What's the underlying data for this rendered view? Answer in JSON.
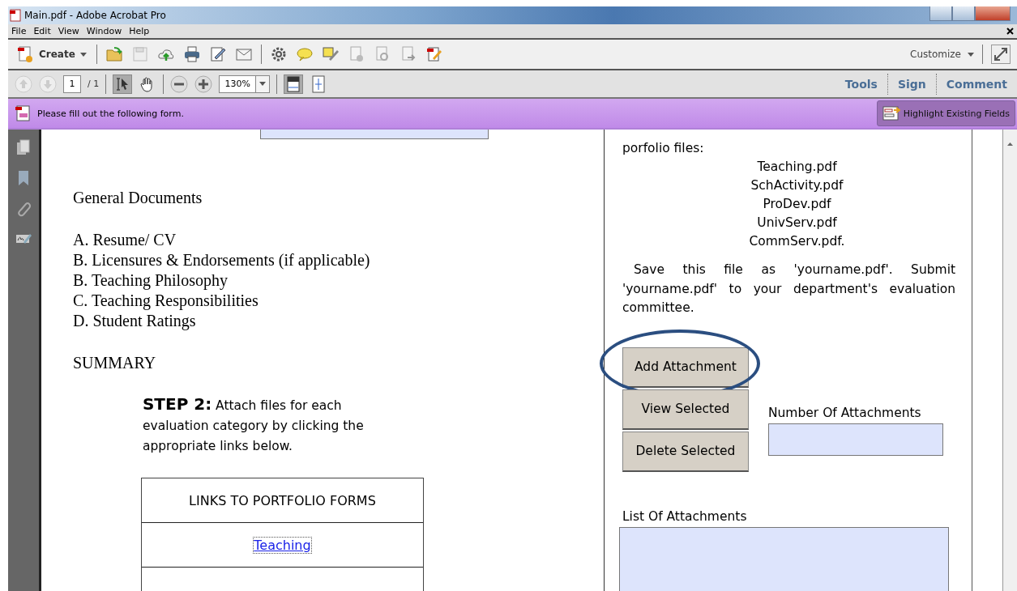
{
  "window": {
    "title": "Main.pdf - Adobe Acrobat Pro"
  },
  "menu": [
    "File",
    "Edit",
    "View",
    "Window",
    "Help"
  ],
  "toolbar": {
    "create": "Create",
    "customize": "Customize"
  },
  "navigation": {
    "page": "1",
    "page_total": "/ 1",
    "zoom": "130%",
    "panes": [
      "Tools",
      "Sign",
      "Comment"
    ]
  },
  "form_bar": {
    "message": "Please fill out the following form.",
    "button": "Highlight Existing Fields"
  },
  "document": {
    "left": {
      "heading": "General Documents",
      "items": [
        "A. Resume/ CV",
        "B. Licensures & Endorsements (if applicable)",
        "B. Teaching Philosophy",
        "C. Teaching Responsibilities",
        "D. Student Ratings"
      ],
      "summary": "SUMMARY",
      "step_label": "STEP 2:",
      "step_text": "Attach files for each evaluation category by clicking the appropriate links below.",
      "links_table": {
        "header": "LINKS TO PORTFOLIO FORMS",
        "links": [
          {
            "label": "Teaching",
            "focused": true
          }
        ]
      }
    },
    "right": {
      "intro": "porfolio files:",
      "files": [
        "Teaching.pdf",
        "SchActivity.pdf",
        "ProDev.pdf",
        "UnivServ.pdf",
        "CommServ.pdf."
      ],
      "note": "Save this file as 'yourname.pdf'.  Submit 'yourname.pdf' to your department's evaluation committee.",
      "buttons": [
        {
          "label": "Add Attachment",
          "circled": true
        },
        {
          "label": "View Selected",
          "circled": false
        },
        {
          "label": "Delete Selected",
          "circled": false
        }
      ],
      "count_label": "Number Of Attachments",
      "list_label": "List Of Attachments"
    }
  }
}
